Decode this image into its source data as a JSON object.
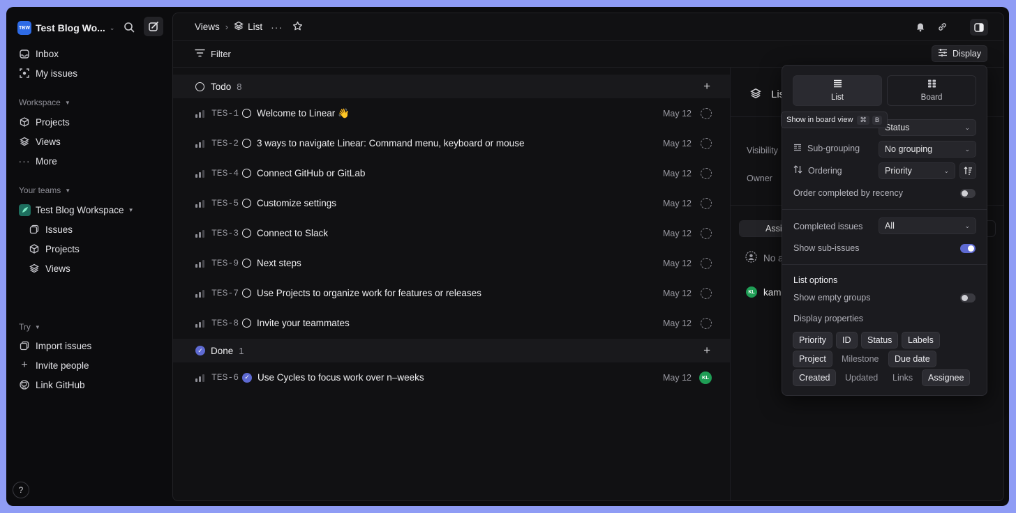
{
  "workspace": {
    "logo": "TBW",
    "name": "Test Blog Wo..."
  },
  "sidebar": {
    "top_items": [
      {
        "label": "Inbox",
        "icon": "inbox-icon"
      },
      {
        "label": "My issues",
        "icon": "my-issues-icon"
      }
    ],
    "workspace_label": "Workspace",
    "workspace_items": [
      {
        "label": "Projects",
        "icon": "cube-icon"
      },
      {
        "label": "Views",
        "icon": "layers-icon"
      },
      {
        "label": "More",
        "icon": "more-icon"
      }
    ],
    "teams_label": "Your teams",
    "team_name": "Test Blog Workspace",
    "team_items": [
      {
        "label": "Issues",
        "icon": "issues-icon"
      },
      {
        "label": "Projects",
        "icon": "cube-icon"
      },
      {
        "label": "Views",
        "icon": "layers-icon"
      }
    ],
    "try_label": "Try",
    "try_items": [
      {
        "label": "Import issues",
        "icon": "import-icon"
      },
      {
        "label": "Invite people",
        "icon": "plus-icon"
      },
      {
        "label": "Link GitHub",
        "icon": "github-icon"
      }
    ],
    "help": "?"
  },
  "header": {
    "breadcrumb_root": "Views",
    "separator": "›",
    "view_name": "List"
  },
  "filter_bar": {
    "filter_label": "Filter",
    "display_label": "Display"
  },
  "groups": [
    {
      "name": "Todo",
      "count": "8",
      "issues": [
        {
          "id": "TES-1",
          "title": "Welcome to Linear 👋",
          "date": "May 12",
          "assignee": ""
        },
        {
          "id": "TES-2",
          "title": "3 ways to navigate Linear: Command menu, keyboard or mouse",
          "date": "May 12",
          "assignee": ""
        },
        {
          "id": "TES-4",
          "title": "Connect GitHub or GitLab",
          "date": "May 12",
          "assignee": ""
        },
        {
          "id": "TES-5",
          "title": "Customize settings",
          "date": "May 12",
          "assignee": ""
        },
        {
          "id": "TES-3",
          "title": "Connect to Slack",
          "date": "May 12",
          "assignee": ""
        },
        {
          "id": "TES-9",
          "title": "Next steps",
          "date": "May 12",
          "assignee": ""
        },
        {
          "id": "TES-7",
          "title": "Use Projects to organize work for features or releases",
          "date": "May 12",
          "assignee": ""
        },
        {
          "id": "TES-8",
          "title": "Invite your teammates",
          "date": "May 12",
          "assignee": ""
        }
      ]
    },
    {
      "name": "Done",
      "count": "1",
      "issues": [
        {
          "id": "TES-6",
          "title": "Use Cycles to focus work over n–weeks",
          "date": "May 12",
          "assignee": "KL"
        }
      ]
    }
  ],
  "right_panel": {
    "title": "Lis",
    "visibility_label": "Visibility",
    "owner_label": "Owner",
    "tab_label": "Assi",
    "no_assignee": "No a",
    "user_initials": "KL",
    "user_name": "kam"
  },
  "display_popover": {
    "list_label": "List",
    "board_label": "Board",
    "tooltip": "Show in board view",
    "tooltip_keys": [
      "⌘",
      "B"
    ],
    "grouping_value": "Status",
    "subgrouping_label": "Sub-grouping",
    "subgrouping_value": "No grouping",
    "ordering_label": "Ordering",
    "ordering_value": "Priority",
    "order_completed_label": "Order completed by recency",
    "completed_issues_label": "Completed issues",
    "completed_issues_value": "All",
    "show_subissues_label": "Show sub-issues",
    "list_options_label": "List options",
    "show_empty_groups_label": "Show empty groups",
    "display_properties_label": "Display properties",
    "properties": [
      {
        "label": "Priority",
        "on": true
      },
      {
        "label": "ID",
        "on": true
      },
      {
        "label": "Status",
        "on": true
      },
      {
        "label": "Labels",
        "on": true
      },
      {
        "label": "Project",
        "on": true
      },
      {
        "label": "Milestone",
        "on": false
      },
      {
        "label": "Due date",
        "on": true
      },
      {
        "label": "Created",
        "on": true
      },
      {
        "label": "Updated",
        "on": false
      },
      {
        "label": "Links",
        "on": false
      },
      {
        "label": "Assignee",
        "on": true
      }
    ],
    "toggles": {
      "order_completed": false,
      "show_subissues": true,
      "show_empty_groups": false
    }
  },
  "colors": {
    "accent": "#5e6ad2",
    "background": "#0c0c0e",
    "frame": "#8f9cf5",
    "avatar": "#1f9d55"
  }
}
